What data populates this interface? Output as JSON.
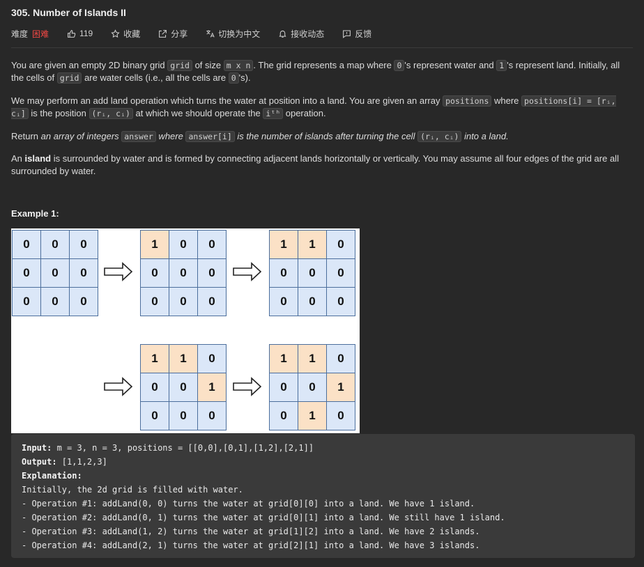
{
  "problem": {
    "title": "305. Number of Islands II",
    "difficulty_label": "难度",
    "difficulty": "困难",
    "likes": "119",
    "favorite": "收藏",
    "share": "分享",
    "translate": "切换为中文",
    "notify": "接收动态",
    "feedback": "反馈"
  },
  "desc": {
    "p1_a": "You are given an empty 2D binary grid ",
    "p1_code1": "grid",
    "p1_b": " of size ",
    "p1_code2": "m x n",
    "p1_c": ". The grid represents a map where ",
    "p1_code3": "0",
    "p1_d": "'s represent water and ",
    "p1_code4": "1",
    "p1_e": "'s represent land. Initially, all the cells of ",
    "p1_code5": "grid",
    "p1_f": " are water cells (i.e., all the cells are ",
    "p1_code6": "0",
    "p1_g": "'s).",
    "p2_a": "We may perform an add land operation which turns the water at position into a land. You are given an array ",
    "p2_code1": "positions",
    "p2_b": " where ",
    "p2_code2": "positions[i] = [rᵢ, cᵢ]",
    "p2_c": " is the position ",
    "p2_code3": "(rᵢ, cᵢ)",
    "p2_d": " at which we should operate the ",
    "p2_code4": "iᵗʰ",
    "p2_e": " operation.",
    "p3_a": "Return ",
    "p3_em1": "an array of integers ",
    "p3_code1": "answer",
    "p3_em2": " where ",
    "p3_code2": "answer[i]",
    "p3_em3": " is the number of islands after turning the cell ",
    "p3_code3": "(rᵢ, cᵢ)",
    "p3_em4": " into a land.",
    "p4_a": "An ",
    "p4_b": "island",
    "p4_c": " is surrounded by water and is formed by connecting adjacent lands horizontally or vertically. You may assume all four edges of the grid are all surrounded by water."
  },
  "example": {
    "title": "Example 1:",
    "grids": [
      [
        [
          "0",
          "0",
          "0"
        ],
        [
          "0",
          "0",
          "0"
        ],
        [
          "0",
          "0",
          "0"
        ]
      ],
      [
        [
          "1",
          "0",
          "0"
        ],
        [
          "0",
          "0",
          "0"
        ],
        [
          "0",
          "0",
          "0"
        ]
      ],
      [
        [
          "1",
          "1",
          "0"
        ],
        [
          "0",
          "0",
          "0"
        ],
        [
          "0",
          "0",
          "0"
        ]
      ],
      [
        [
          "1",
          "1",
          "0"
        ],
        [
          "0",
          "0",
          "1"
        ],
        [
          "0",
          "0",
          "0"
        ]
      ],
      [
        [
          "1",
          "1",
          "0"
        ],
        [
          "0",
          "0",
          "1"
        ],
        [
          "0",
          "1",
          "0"
        ]
      ]
    ],
    "input_label": "Input:",
    "input": " m = 3, n = 3, positions = [[0,0],[0,1],[1,2],[2,1]]",
    "output_label": "Output:",
    "output": " [1,1,2,3]",
    "explanation_label": "Explanation:",
    "explanation_lines": [
      "Initially, the 2d grid is filled with water.",
      "- Operation #1: addLand(0, 0) turns the water at grid[0][0] into a land. We have 1 island.",
      "- Operation #2: addLand(0, 1) turns the water at grid[0][1] into a land. We still have 1 island.",
      "- Operation #3: addLand(1, 2) turns the water at grid[1][2] into a land. We have 2 islands.",
      "- Operation #4: addLand(2, 1) turns the water at grid[2][1] into a land. We have 3 islands."
    ]
  },
  "colors": {
    "water": "#dbe7f8",
    "land": "#fbe1c6",
    "difficulty": "#ef4743"
  }
}
